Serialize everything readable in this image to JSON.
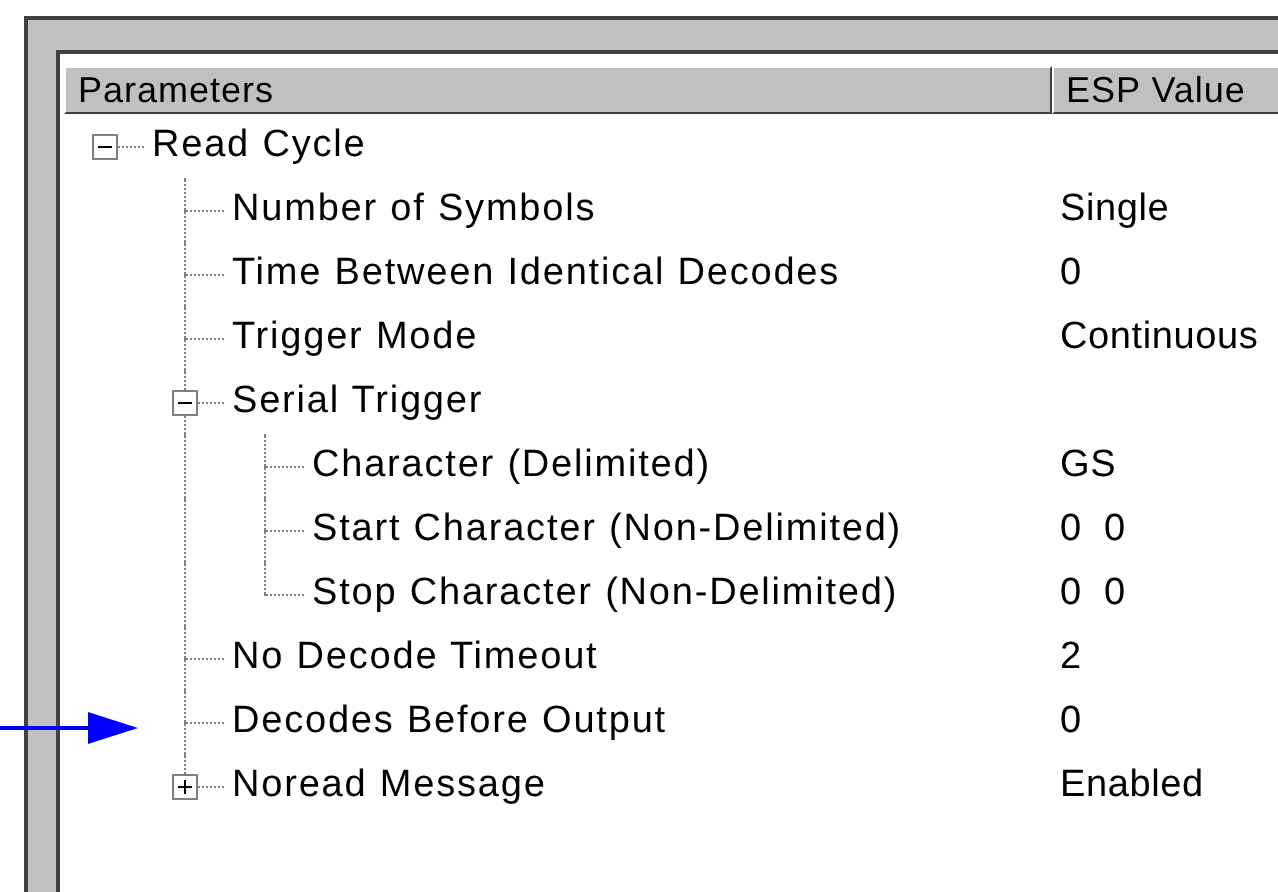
{
  "table": {
    "columns": [
      "Parameters",
      "ESP Value"
    ]
  },
  "tree": [
    {
      "label": "Read Cycle",
      "expanded": true,
      "children": [
        {
          "label": "Number of Symbols",
          "value": "Single"
        },
        {
          "label": "Time Between Identical Decodes",
          "value": "0"
        },
        {
          "label": "Trigger Mode",
          "value": "Continuous"
        },
        {
          "label": "Serial Trigger",
          "expanded": true,
          "children": [
            {
              "label": "Character (Delimited)",
              "value": "GS"
            },
            {
              "label": "Start Character (Non-Delimited)",
              "value": "0  0"
            },
            {
              "label": "Stop Character (Non-Delimited)",
              "value": "0  0"
            }
          ]
        },
        {
          "label": "No Decode Timeout",
          "value": "2"
        },
        {
          "label": "Decodes Before Output",
          "value": "0"
        },
        {
          "label": "Noread Message",
          "expanded": false,
          "value": "Enabled"
        }
      ]
    }
  ]
}
